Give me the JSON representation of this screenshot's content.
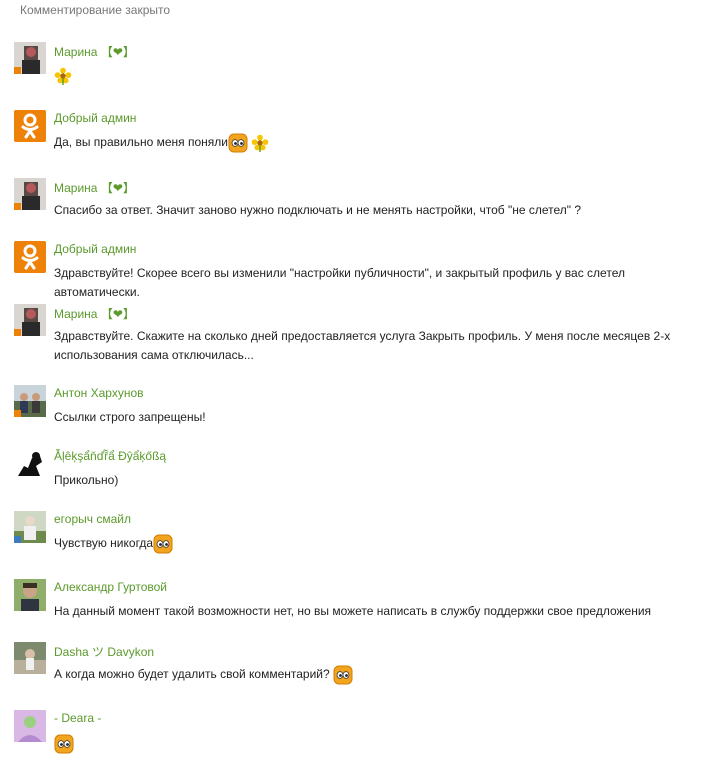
{
  "header": {
    "status": "Комментирование закрыто"
  },
  "comments": [
    {
      "name": "Марина",
      "name_suffix": "【❤】",
      "text": ""
    },
    {
      "name": "Добрый админ",
      "text": "Да, вы правильно меня поняли"
    },
    {
      "name": "Марина",
      "name_suffix": "【❤】",
      "text": "Спасибо за ответ. Значит заново нужно подключать и не менять настройки, чтоб \"не слетел\" ?"
    },
    {
      "name": "Добрый админ",
      "text": "Здравствуйте! Скорее всего вы изменили \"настройки публичности\", и закрытый профиль у вас слетел автоматически."
    },
    {
      "name": "Марина",
      "name_suffix": "【❤】",
      "text": "Здравствуйте. Скажите на сколько дней предоставляется услуга Закрыть профиль. У меня после месяцев 2-х использования сама отключилась..."
    },
    {
      "name": "Антон Хархунов",
      "text": "Ссылки строго запрещены!"
    },
    {
      "name": "Ẫļȇķşẩňďř̃ẩ Ɖŷẩķőßą",
      "text": "Прикольно)"
    },
    {
      "name": "егорыч смайл",
      "text": "Чувствую никогда"
    },
    {
      "name": "Александр Гуртовой",
      "text": "На данный момент такой возможности нет, но вы можете написать в службу поддержки свое предложения"
    },
    {
      "name": "Dasha ツ Davykon",
      "text": "А когда можно будет удалить свой комментарий?"
    },
    {
      "name": "- Deara -",
      "text": ""
    }
  ],
  "colors": {
    "name": "#5b9a2b",
    "ok_orange": "#ee8208",
    "badge_blue": "#3d7abf"
  },
  "icons": {
    "ok_logo": "ok-logo-icon",
    "flower": "flower-emoji-icon",
    "smiley": "smiley-emoji-icon"
  }
}
